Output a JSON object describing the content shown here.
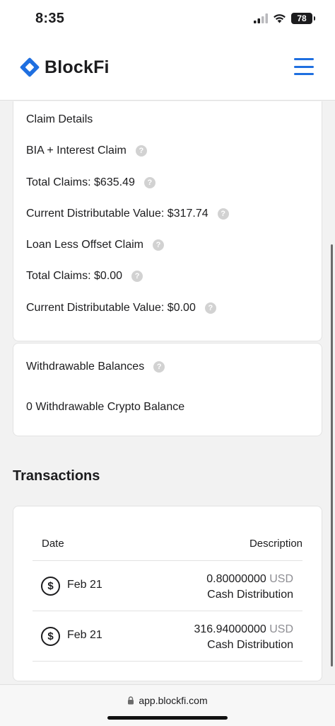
{
  "status_bar": {
    "time": "8:35",
    "battery": "78",
    "icons": [
      "signal-bars-icon",
      "wifi-icon",
      "battery-icon"
    ]
  },
  "header": {
    "brand_name": "BlockFi",
    "logo_icon": "blockfi-diamond-logo",
    "menu_icon": "hamburger-menu-icon"
  },
  "claim_details": {
    "title": "Claim Details",
    "bia_label": "BIA + Interest Claim",
    "bia_total": "Total Claims: $635.49",
    "bia_distributable": "Current Distributable Value: $317.74",
    "loan_label": "Loan Less Offset Claim",
    "loan_total": "Total Claims: $0.00",
    "loan_distributable": "Current Distributable Value: $0.00",
    "help_glyph": "?"
  },
  "withdrawable": {
    "title": "Withdrawable Balances",
    "balance": "0 Withdrawable Crypto Balance"
  },
  "transactions": {
    "title": "Transactions",
    "columns": {
      "date": "Date",
      "description": "Description"
    },
    "rows": [
      {
        "date": "Feb 21",
        "amount": "0.80000000",
        "unit": "USD",
        "description": "Cash Distribution"
      },
      {
        "date": "Feb 21",
        "amount": "316.94000000",
        "unit": "USD",
        "description": "Cash Distribution"
      }
    ],
    "row_icon": "dollar-circle-icon",
    "row_glyph": "$"
  },
  "browser": {
    "url": "app.blockfi.com",
    "lock_icon": "lock-icon"
  },
  "colors": {
    "brand_blue": "#1f6fe0",
    "background": "#f2f2f2",
    "card": "#ffffff",
    "help_icon": "#d2d2d2",
    "muted_text": "#8e8e93"
  }
}
